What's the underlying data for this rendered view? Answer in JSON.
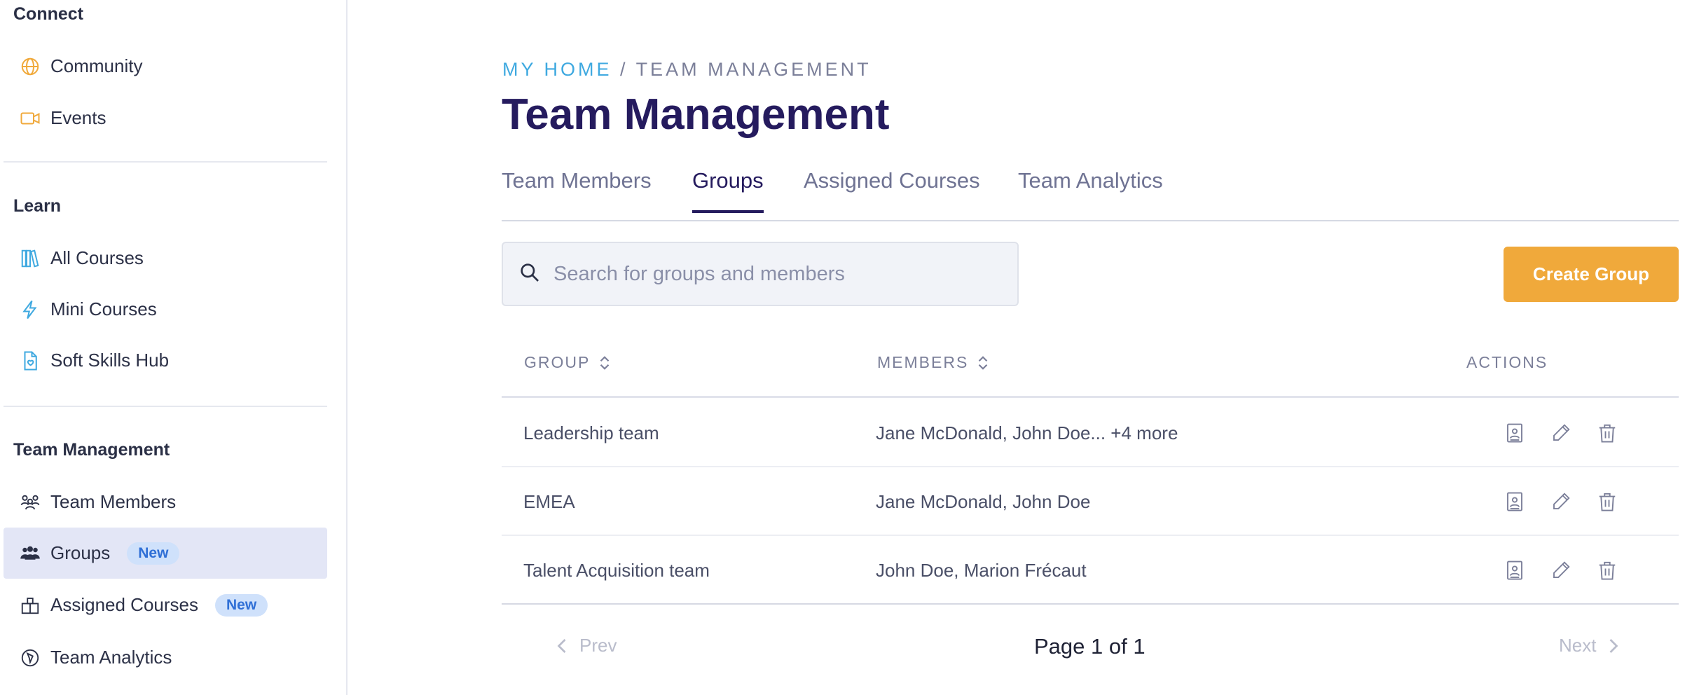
{
  "sidebar": {
    "connect_title": "Connect",
    "connect_items": [
      {
        "label": "Community",
        "icon": "globe-icon"
      },
      {
        "label": "Events",
        "icon": "video-icon"
      }
    ],
    "learn_title": "Learn",
    "learn_items": [
      {
        "label": "All Courses",
        "icon": "books-icon"
      },
      {
        "label": "Mini Courses",
        "icon": "lightning-icon"
      },
      {
        "label": "Soft Skills Hub",
        "icon": "document-heart-icon"
      }
    ],
    "team_title": "Team Management",
    "team_items": [
      {
        "label": "Team Members",
        "icon": "users-icon"
      },
      {
        "label": "Groups",
        "icon": "group-icon",
        "badge": "New",
        "active": true
      },
      {
        "label": "Assigned Courses",
        "icon": "gift-icon",
        "badge": "New"
      },
      {
        "label": "Team Analytics",
        "icon": "compass-icon"
      }
    ]
  },
  "breadcrumb": {
    "home": "MY HOME",
    "separator": "/",
    "current": "TEAM MANAGEMENT"
  },
  "page_title": "Team Management",
  "tabs": [
    {
      "label": "Team Members"
    },
    {
      "label": "Groups",
      "active": true
    },
    {
      "label": "Assigned Courses"
    },
    {
      "label": "Team Analytics"
    }
  ],
  "search": {
    "placeholder": "Search for groups and members",
    "value": ""
  },
  "create_button": "Create Group",
  "table": {
    "headers": {
      "group": "GROUP",
      "members": "MEMBERS",
      "actions": "ACTIONS"
    },
    "rows": [
      {
        "group": "Leadership team",
        "members": "Jane McDonald, John Doe... +4 more"
      },
      {
        "group": "EMEA",
        "members": "Jane McDonald, John Doe"
      },
      {
        "group": "Talent Acquisition team",
        "members": "John Doe, Marion Frécaut"
      }
    ]
  },
  "pagination": {
    "prev": "Prev",
    "info": "Page 1 of 1",
    "next": "Next"
  },
  "colors": {
    "accent_orange": "#f0a93b",
    "title_navy": "#251b5e",
    "breadcrumb_blue": "#3fa9e0",
    "active_bg": "#e3e6f6",
    "badge_bg": "#cfe1fb"
  }
}
